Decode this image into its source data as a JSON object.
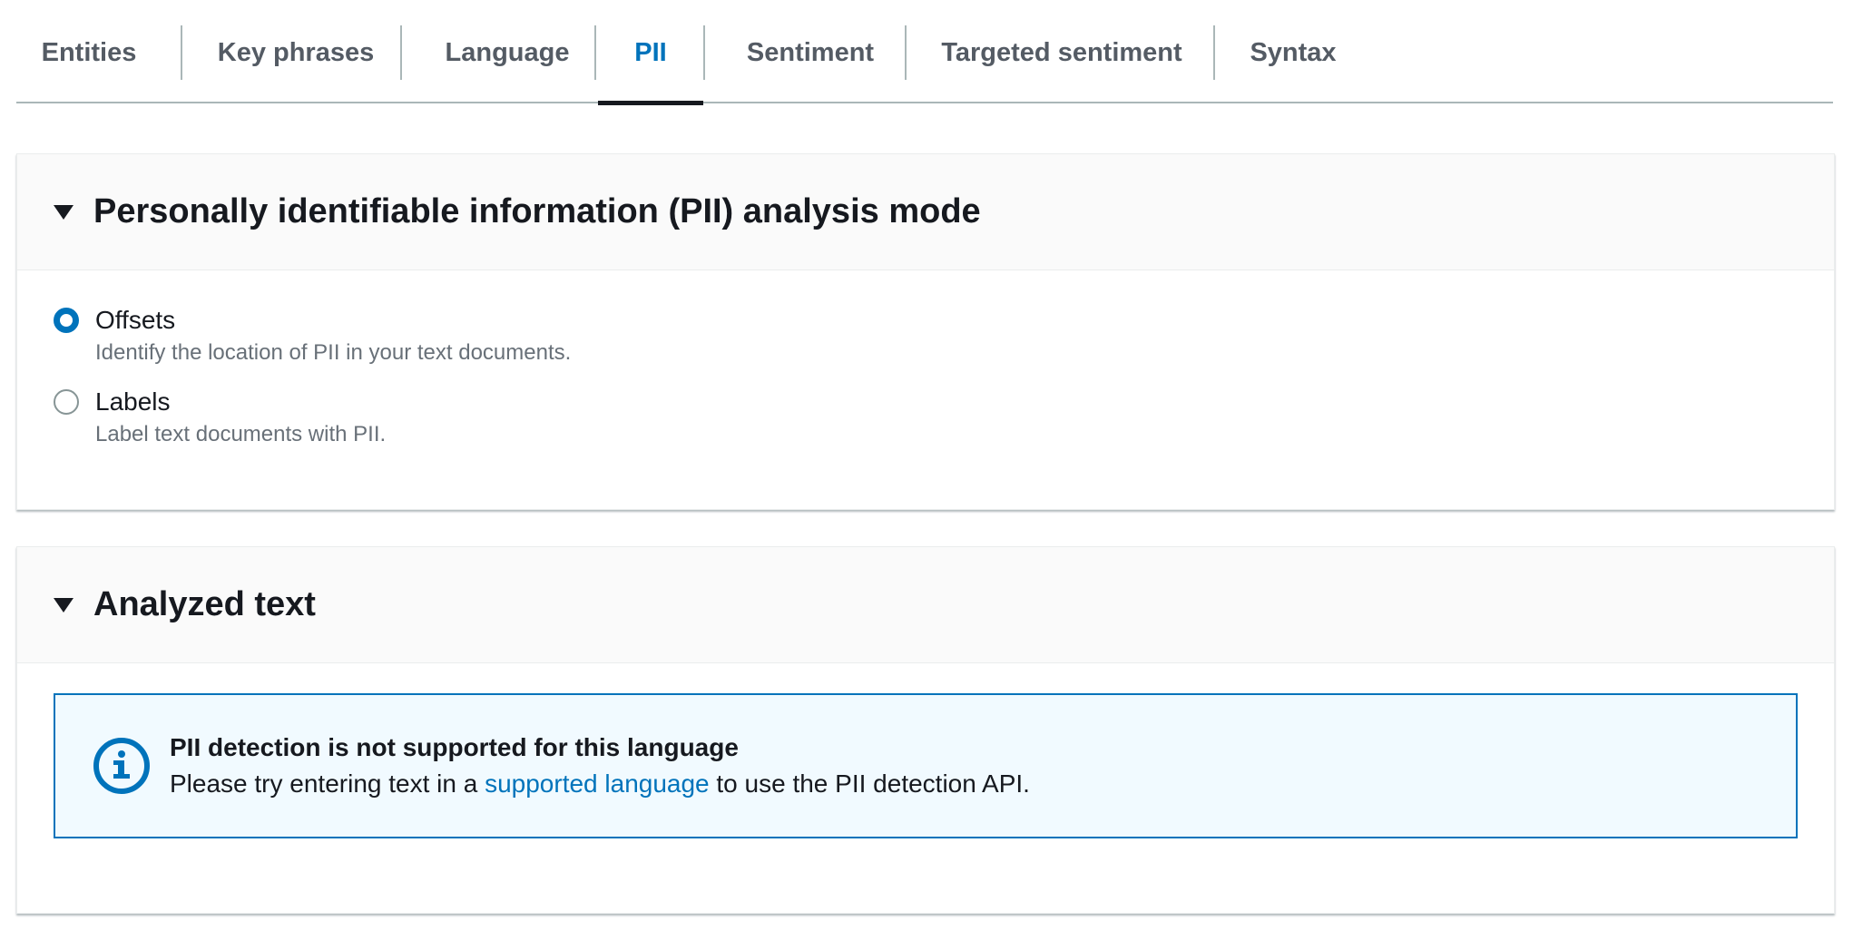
{
  "tabs": [
    {
      "label": "Entities",
      "active": false
    },
    {
      "label": "Key phrases",
      "active": false
    },
    {
      "label": "Language",
      "active": false
    },
    {
      "label": "PII",
      "active": true
    },
    {
      "label": "Sentiment",
      "active": false
    },
    {
      "label": "Targeted sentiment",
      "active": false
    },
    {
      "label": "Syntax",
      "active": false
    }
  ],
  "pii_mode_panel": {
    "title": "Personally identifiable information (PII) analysis mode",
    "options": [
      {
        "label": "Offsets",
        "description": "Identify the location of PII in your text documents.",
        "selected": true
      },
      {
        "label": "Labels",
        "description": "Label text documents with PII.",
        "selected": false
      }
    ]
  },
  "analyzed_panel": {
    "title": "Analyzed text",
    "alert": {
      "icon": "info-icon",
      "title": "PII detection is not supported for this language",
      "body_before": "Please try entering text in a ",
      "link_text": "supported language",
      "body_after": " to use the PII detection API."
    }
  },
  "colors": {
    "accent": "#0073bb",
    "text": "#16191f",
    "muted": "#545b64",
    "alert_bg": "#f1faff"
  }
}
